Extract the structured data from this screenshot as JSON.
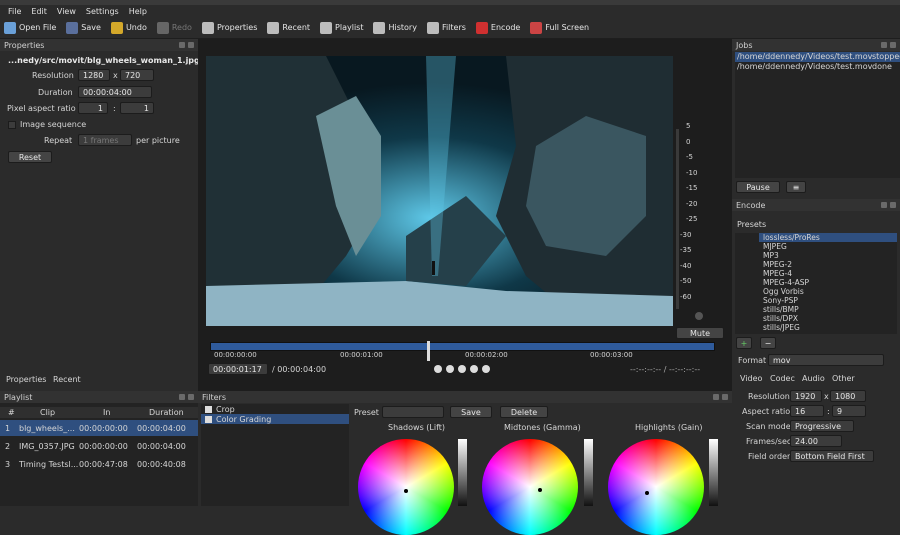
{
  "menu": [
    "File",
    "Edit",
    "View",
    "Settings",
    "Help"
  ],
  "toolbar": [
    {
      "label": "Open File",
      "icon": "open-file-icon",
      "color": "#6aa0d8",
      "enabled": true
    },
    {
      "label": "Save",
      "icon": "save-icon",
      "color": "#5a6f9c",
      "enabled": true
    },
    {
      "label": "Undo",
      "icon": "undo-icon",
      "color": "#d4a82a",
      "enabled": true
    },
    {
      "label": "Redo",
      "icon": "redo-icon",
      "color": "#666666",
      "enabled": false
    },
    {
      "label": "Properties",
      "icon": "properties-icon",
      "color": "#bcbcbc",
      "enabled": true
    },
    {
      "label": "Recent",
      "icon": "recent-icon",
      "color": "#bcbcbc",
      "enabled": true
    },
    {
      "label": "Playlist",
      "icon": "playlist-icon",
      "color": "#bcbcbc",
      "enabled": true
    },
    {
      "label": "History",
      "icon": "history-icon",
      "color": "#bcbcbc",
      "enabled": true
    },
    {
      "label": "Filters",
      "icon": "filters-icon",
      "color": "#bcbcbc",
      "enabled": true
    },
    {
      "label": "Encode",
      "icon": "encode-icon",
      "color": "#d03030",
      "enabled": true
    },
    {
      "label": "Full Screen",
      "icon": "full-screen-icon",
      "color": "#cc4444",
      "enabled": true
    }
  ],
  "properties": {
    "title": "Properties",
    "filename": "...nedy/src/movit/blg_wheels_woman_1.jpg",
    "resolution_label": "Resolution",
    "res_w": "1280",
    "res_x": "x",
    "res_h": "720",
    "duration_label": "Duration",
    "duration": "00:00:04:00",
    "par_label": "Pixel aspect ratio",
    "par_a": "1",
    "par_sep": ":",
    "par_b": "1",
    "image_seq_label": "Image sequence",
    "repeat_label": "Repeat",
    "repeat_value": "1 frames",
    "per_picture": "per picture",
    "reset": "Reset",
    "tabs": [
      "Properties",
      "Recent"
    ]
  },
  "playlist": {
    "title": "Playlist",
    "headers": [
      "#",
      "Clip",
      "In",
      "Duration"
    ],
    "rows": [
      [
        "1",
        "blg_wheels_...",
        "00:00:00:00",
        "00:00:04:00"
      ],
      [
        "2",
        "IMG_0357.JPG",
        "00:00:00:00",
        "00:00:04:00"
      ],
      [
        "3",
        "Timing Testsl...",
        "00:00:47:08",
        "00:00:40:08"
      ]
    ]
  },
  "player": {
    "ticks": [
      "00:00:00:00",
      "00:00:01:00",
      "00:00:02:00",
      "00:00:03:00"
    ],
    "position": "00:00:01:17",
    "duration": "/ 00:00:04:00",
    "inout": "--:--:--:-- / --:--:--:--",
    "meter_labels": [
      "5",
      "0",
      "-5",
      "-10",
      "-15",
      "-20",
      "-25",
      "-30",
      "-35",
      "-40",
      "-50",
      "-60"
    ],
    "mute": "Mute"
  },
  "filters": {
    "title": "Filters",
    "items": [
      {
        "label": "Crop",
        "checked": true
      },
      {
        "label": "Color Grading",
        "checked": true
      }
    ],
    "preset_label": "Preset",
    "save": "Save",
    "delete": "Delete",
    "wheels": [
      "Shadows (Lift)",
      "Midtones (Gamma)",
      "Highlights (Gain)"
    ]
  },
  "jobs": {
    "title": "Jobs",
    "rows": [
      [
        "/home/ddennedy/Videos/test.mov",
        "stopped"
      ],
      [
        "/home/ddennedy/Videos/test.mov",
        "done"
      ]
    ],
    "pause": "Pause"
  },
  "encode": {
    "title": "Encode",
    "presets_label": "Presets",
    "presets": [
      "lossless/ProRes",
      "MJPEG",
      "MP3",
      "MPEG-2",
      "MPEG-4",
      "MPEG-4-ASP",
      "Ogg Vorbis",
      "Sony-PSP",
      "stills/BMP",
      "stills/DPX",
      "stills/JPEG"
    ],
    "format_label": "Format",
    "format": "mov",
    "tabs": [
      "Video",
      "Codec",
      "Audio",
      "Other"
    ],
    "resolution_label": "Resolution",
    "res_w": "1920",
    "res_x": "x",
    "res_h": "1080",
    "aspect_label": "Aspect ratio",
    "asp_a": "16",
    "asp_sep": ":",
    "asp_b": "9",
    "scan_label": "Scan mode",
    "scan": "Progressive",
    "fps_label": "Frames/sec",
    "fps": "24.00",
    "field_label": "Field order",
    "field": "Bottom Field First"
  }
}
